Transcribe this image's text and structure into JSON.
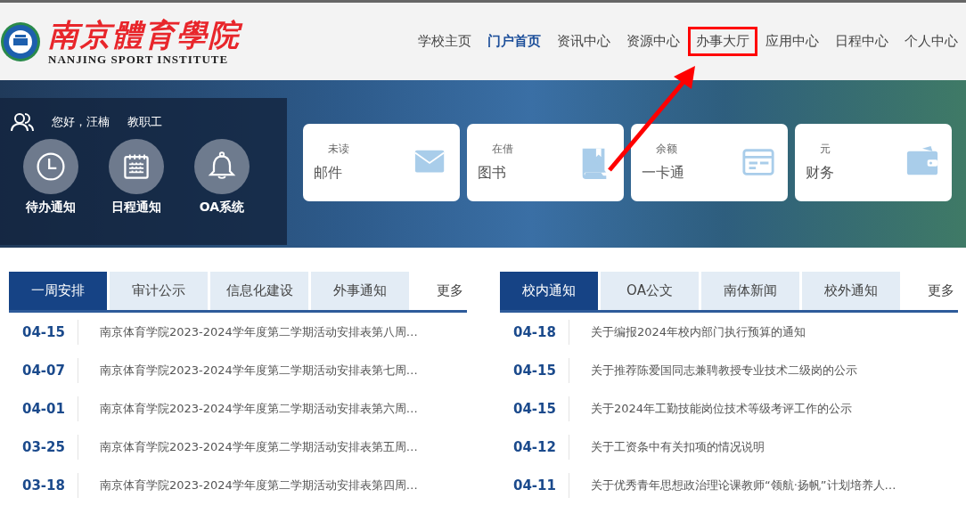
{
  "logo": {
    "title": "南京體育學院",
    "subtitle": "NANJING SPORT INSTITUTE"
  },
  "nav": [
    {
      "label": "学校主页",
      "selected": false,
      "highlighted": false
    },
    {
      "label": "门户首页",
      "selected": true,
      "highlighted": false
    },
    {
      "label": "资讯中心",
      "selected": false,
      "highlighted": false
    },
    {
      "label": "资源中心",
      "selected": false,
      "highlighted": false
    },
    {
      "label": "办事大厅",
      "selected": false,
      "highlighted": true
    },
    {
      "label": "应用中心",
      "selected": false,
      "highlighted": false
    },
    {
      "label": "日程中心",
      "selected": false,
      "highlighted": false
    },
    {
      "label": "个人中心",
      "selected": false,
      "highlighted": false
    }
  ],
  "user": {
    "greeting": "您好，汪楠",
    "role": "教职工"
  },
  "shortcuts": [
    {
      "label": "待办通知"
    },
    {
      "label": "日程通知"
    },
    {
      "label": "OA系统"
    }
  ],
  "cards": [
    {
      "caption": "未读",
      "title": "邮件"
    },
    {
      "caption": "在借",
      "title": "图书"
    },
    {
      "caption": "余额",
      "title": "一卡通"
    },
    {
      "caption": "元",
      "title": "财务"
    }
  ],
  "panels": [
    {
      "tabs": [
        {
          "label": "一周安排",
          "selected": true
        },
        {
          "label": "审计公示",
          "selected": false
        },
        {
          "label": "信息化建设",
          "selected": false
        },
        {
          "label": "外事通知",
          "selected": false
        }
      ],
      "more": "更多",
      "rows": [
        {
          "date": "04-15",
          "title": "南京体育学院2023-2024学年度第二学期活动安排表第八周…"
        },
        {
          "date": "04-07",
          "title": "南京体育学院2023-2024学年度第二学期活动安排表第七周…"
        },
        {
          "date": "04-01",
          "title": "南京体育学院2023-2024学年度第二学期活动安排表第六周…"
        },
        {
          "date": "03-25",
          "title": "南京体育学院2023-2024学年度第二学期活动安排表第五周…"
        },
        {
          "date": "03-18",
          "title": "南京体育学院2023-2024学年度第二学期活动安排表第四周…"
        }
      ]
    },
    {
      "tabs": [
        {
          "label": "校内通知",
          "selected": true
        },
        {
          "label": "OA公文",
          "selected": false
        },
        {
          "label": "南体新闻",
          "selected": false
        },
        {
          "label": "校外通知",
          "selected": false
        }
      ],
      "more": "更多",
      "rows": [
        {
          "date": "04-18",
          "title": "关于编报2024年校内部门执行预算的通知"
        },
        {
          "date": "04-15",
          "title": "关于推荐陈爱国同志兼聘教授专业技术二级岗的公示"
        },
        {
          "date": "04-15",
          "title": "关于2024年工勤技能岗位技术等级考评工作的公示"
        },
        {
          "date": "04-12",
          "title": "关于工资条中有关扣项的情况说明"
        },
        {
          "date": "04-11",
          "title": "关于优秀青年思想政治理论课教师“领航·扬帆”计划培养人…"
        }
      ]
    }
  ]
}
